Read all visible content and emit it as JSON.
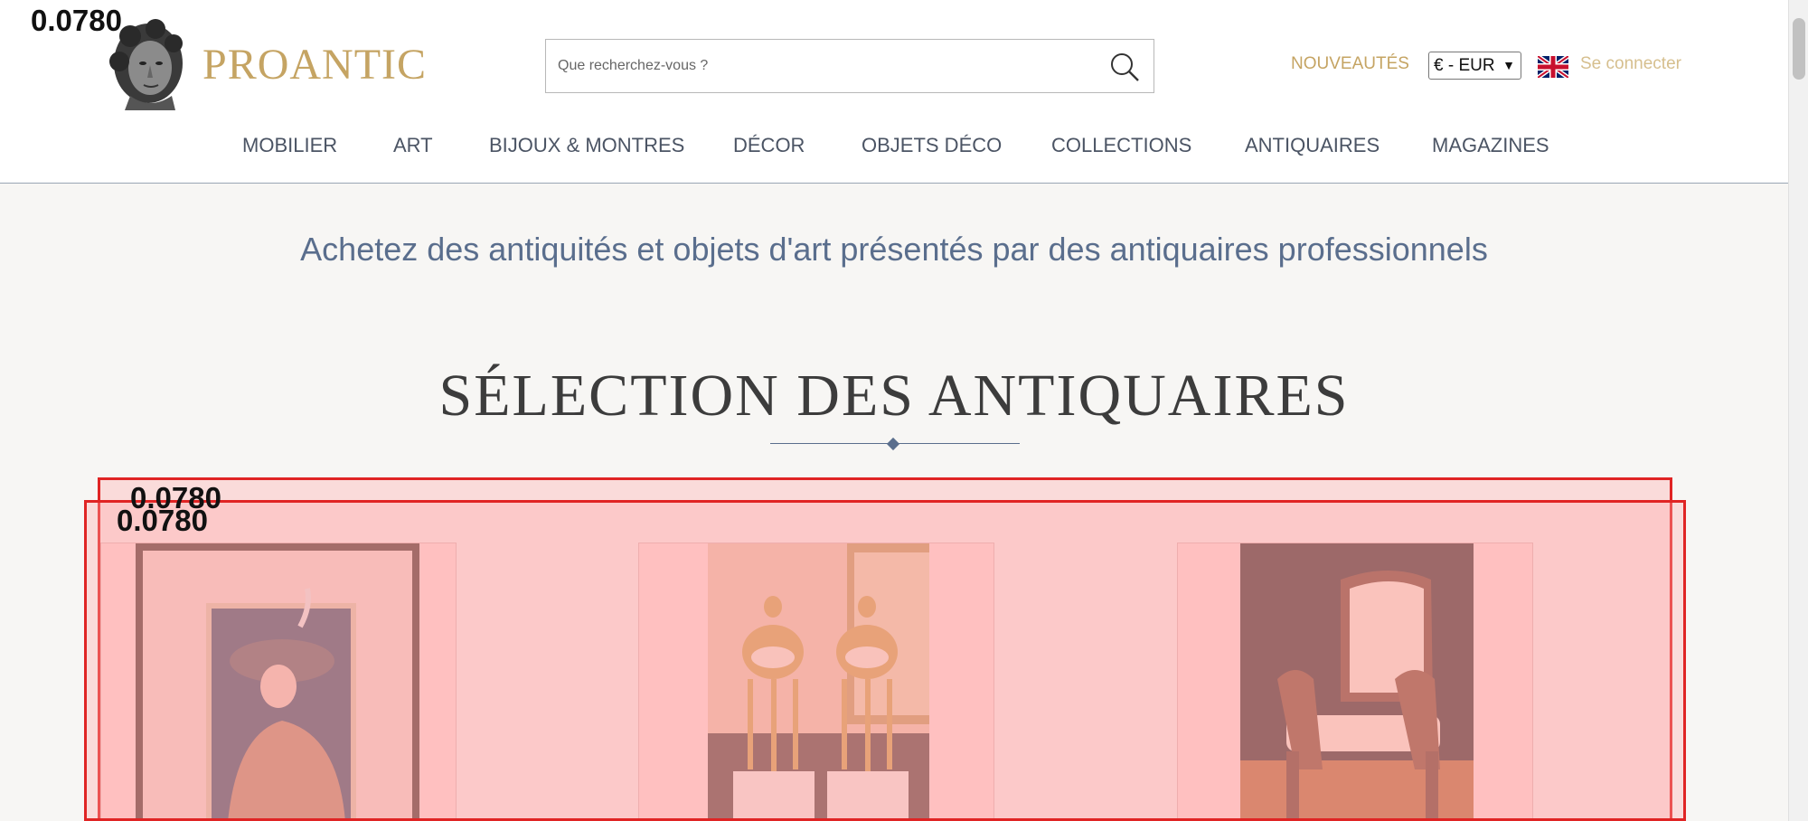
{
  "overlay_scores": {
    "top_left": "0.0780",
    "panel_a": "0.0780",
    "panel_b": "0.0780"
  },
  "header": {
    "brand": "PROANTIC",
    "search_placeholder": "Que recherchez-vous ?",
    "new_label": "NOUVEAUTÉS",
    "currency": "€ - EUR",
    "login_label": "Se connecter"
  },
  "nav": [
    "MOBILIER",
    "ART",
    "BIJOUX & MONTRES",
    "DÉCOR",
    "OBJETS DÉCO",
    "COLLECTIONS",
    "ANTIQUAIRES",
    "MAGAZINES"
  ],
  "tagline": "Achetez des antiquités et objets d'art présentés par des antiquaires professionnels",
  "section_title": "SÉLECTION DES ANTIQUAIRES",
  "colors": {
    "gold": "#c5a463",
    "slate": "#5a6e8d",
    "overlay_red": "#e02424"
  },
  "icons": [
    "bust-logo-icon",
    "search-icon",
    "uk-flag-icon",
    "chevron-down-icon"
  ]
}
